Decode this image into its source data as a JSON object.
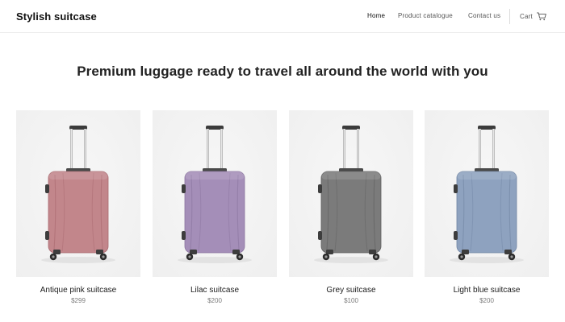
{
  "header": {
    "logo": "Stylish suitcase",
    "nav": [
      {
        "label": "Home",
        "active": true
      },
      {
        "label": "Product catalogue",
        "active": false
      },
      {
        "label": "Contact us",
        "active": false
      }
    ],
    "cart_label": "Cart",
    "cart_icon": "cart-icon"
  },
  "hero": {
    "title": "Premium luggage ready to travel all around the world with you"
  },
  "products": [
    {
      "name": "Antique pink suitcase",
      "price": "$299",
      "color": "#c2868b",
      "color_dark": "#a8696f"
    },
    {
      "name": "Lilac suitcase",
      "price": "$200",
      "color": "#a48eb8",
      "color_dark": "#8a749e"
    },
    {
      "name": "Grey suitcase",
      "price": "$100",
      "color": "#7b7b7b",
      "color_dark": "#5f5f5f"
    },
    {
      "name": "Light blue suitcase",
      "price": "$200",
      "color": "#8ea2bf",
      "color_dark": "#7186a4"
    }
  ]
}
